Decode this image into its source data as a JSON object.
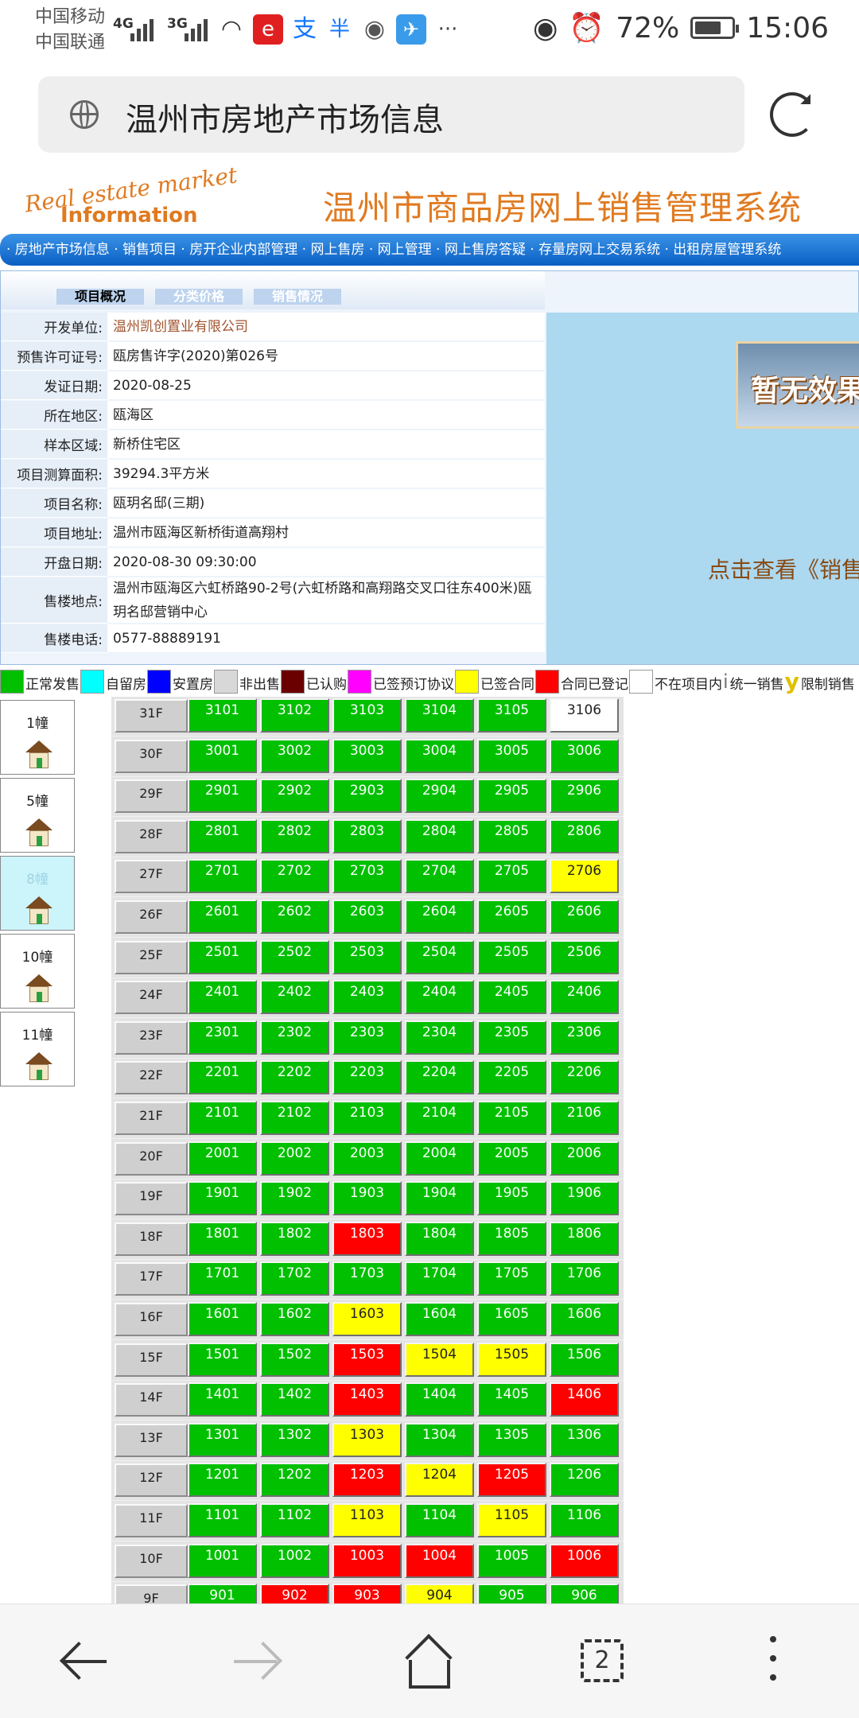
{
  "status": {
    "carrier1": "中国移动",
    "carrier2": "中国联通",
    "net1": "4G",
    "net2": "3G",
    "battery_pct": "72%",
    "time": "15:06",
    "more": "···",
    "battery_level": 0.72,
    "app_icons": [
      "eye-icon",
      "alarm-icon",
      "wifi-icon",
      "red-app-icon",
      "alipay-icon",
      "bank-app-icon",
      "wechat-icon",
      "mail-app-icon"
    ]
  },
  "browser": {
    "url_title": "温州市房地产市场信息",
    "tab_count": "2"
  },
  "site": {
    "logo_line1": "Real estate market",
    "logo_line2": "Information",
    "system_title": "温州市商品房网上销售管理系统",
    "nav_text": "· 房地产市场信息 · 销售项目 · 房开企业内部管理 · 网上售房 · 网上管理 · 网上售房答疑 · 存量房网上交易系统 · 出租房屋管理系统"
  },
  "tabs": [
    "项目概况",
    "分类价格",
    "销售情况"
  ],
  "info": [
    {
      "label": "开发单位:",
      "value": "温州凯创置业有限公司",
      "link": true
    },
    {
      "label": "预售许可证号:",
      "value": "瓯房售许字(2020)第026号"
    },
    {
      "label": "发证日期:",
      "value": "2020-08-25"
    },
    {
      "label": "所在地区:",
      "value": "瓯海区"
    },
    {
      "label": "样本区域:",
      "value": "新桥住宅区"
    },
    {
      "label": "项目测算面积:",
      "value": "39294.3平方米"
    },
    {
      "label": "项目名称:",
      "value": "瓯玥名邸(三期)"
    },
    {
      "label": "项目地址:",
      "value": "温州市瓯海区新桥街道高翔村"
    },
    {
      "label": "开盘日期:",
      "value": "2020-08-30 09:30:00"
    },
    {
      "label": "售楼地点:",
      "value": "温州市瓯海区六虹桥路90-2号(六虹桥路和高翔路交叉口往东400米)瓯玥名邸营销中心"
    },
    {
      "label": "售楼电话:",
      "value": "0577-88889191"
    }
  ],
  "right_panel": {
    "no_image_text": "暂无效果",
    "click_view_text": "点击查看《销售"
  },
  "legend": [
    {
      "type": "swatch",
      "color": "#00c000",
      "label": "正常发售"
    },
    {
      "type": "swatch",
      "color": "#00ffff",
      "label": "自留房"
    },
    {
      "type": "swatch",
      "color": "#0000ff",
      "label": "安置房"
    },
    {
      "type": "swatch",
      "color": "#d8d8d8",
      "label": "非出售"
    },
    {
      "type": "swatch",
      "color": "#6b0000",
      "label": "已认购"
    },
    {
      "type": "swatch",
      "color": "#ff00ff",
      "label": "已签预订协议"
    },
    {
      "type": "swatch",
      "color": "#ffff00",
      "label": "已签合同"
    },
    {
      "type": "swatch",
      "color": "#ff0000",
      "label": "合同已登记"
    },
    {
      "type": "swatch",
      "color": "#ffffff",
      "label": "不在项目内"
    },
    {
      "type": "glyph",
      "glyph": "i",
      "label": "统一销售"
    },
    {
      "type": "glyph",
      "glyph": "y",
      "label": "限制销售"
    }
  ],
  "buildings": [
    {
      "name": "1幢",
      "selected": false
    },
    {
      "name": "5幢",
      "selected": false
    },
    {
      "name": "8幢",
      "selected": true
    },
    {
      "name": "10幢",
      "selected": false
    },
    {
      "name": "11幢",
      "selected": false
    }
  ],
  "floors": [
    {
      "floor": "31F",
      "units": [
        "3101",
        "3102",
        "3103",
        "3104",
        "3105",
        "3106"
      ],
      "status": [
        "g",
        "g",
        "g",
        "g",
        "g",
        "w"
      ]
    },
    {
      "floor": "30F",
      "units": [
        "3001",
        "3002",
        "3003",
        "3004",
        "3005",
        "3006"
      ],
      "status": [
        "g",
        "g",
        "g",
        "g",
        "g",
        "g"
      ]
    },
    {
      "floor": "29F",
      "units": [
        "2901",
        "2902",
        "2903",
        "2904",
        "2905",
        "2906"
      ],
      "status": [
        "g",
        "g",
        "g",
        "g",
        "g",
        "g"
      ]
    },
    {
      "floor": "28F",
      "units": [
        "2801",
        "2802",
        "2803",
        "2804",
        "2805",
        "2806"
      ],
      "status": [
        "g",
        "g",
        "g",
        "g",
        "g",
        "g"
      ]
    },
    {
      "floor": "27F",
      "units": [
        "2701",
        "2702",
        "2703",
        "2704",
        "2705",
        "2706"
      ],
      "status": [
        "g",
        "g",
        "g",
        "g",
        "g",
        "y"
      ]
    },
    {
      "floor": "26F",
      "units": [
        "2601",
        "2602",
        "2603",
        "2604",
        "2605",
        "2606"
      ],
      "status": [
        "g",
        "g",
        "g",
        "g",
        "g",
        "g"
      ]
    },
    {
      "floor": "25F",
      "units": [
        "2501",
        "2502",
        "2503",
        "2504",
        "2505",
        "2506"
      ],
      "status": [
        "g",
        "g",
        "g",
        "g",
        "g",
        "g"
      ]
    },
    {
      "floor": "24F",
      "units": [
        "2401",
        "2402",
        "2403",
        "2404",
        "2405",
        "2406"
      ],
      "status": [
        "g",
        "g",
        "g",
        "g",
        "g",
        "g"
      ]
    },
    {
      "floor": "23F",
      "units": [
        "2301",
        "2302",
        "2303",
        "2304",
        "2305",
        "2306"
      ],
      "status": [
        "g",
        "g",
        "g",
        "g",
        "g",
        "g"
      ]
    },
    {
      "floor": "22F",
      "units": [
        "2201",
        "2202",
        "2203",
        "2204",
        "2205",
        "2206"
      ],
      "status": [
        "g",
        "g",
        "g",
        "g",
        "g",
        "g"
      ]
    },
    {
      "floor": "21F",
      "units": [
        "2101",
        "2102",
        "2103",
        "2104",
        "2105",
        "2106"
      ],
      "status": [
        "g",
        "g",
        "g",
        "g",
        "g",
        "g"
      ]
    },
    {
      "floor": "20F",
      "units": [
        "2001",
        "2002",
        "2003",
        "2004",
        "2005",
        "2006"
      ],
      "status": [
        "g",
        "g",
        "g",
        "g",
        "g",
        "g"
      ]
    },
    {
      "floor": "19F",
      "units": [
        "1901",
        "1902",
        "1903",
        "1904",
        "1905",
        "1906"
      ],
      "status": [
        "g",
        "g",
        "g",
        "g",
        "g",
        "g"
      ]
    },
    {
      "floor": "18F",
      "units": [
        "1801",
        "1802",
        "1803",
        "1804",
        "1805",
        "1806"
      ],
      "status": [
        "g",
        "g",
        "r",
        "g",
        "g",
        "g"
      ]
    },
    {
      "floor": "17F",
      "units": [
        "1701",
        "1702",
        "1703",
        "1704",
        "1705",
        "1706"
      ],
      "status": [
        "g",
        "g",
        "g",
        "g",
        "g",
        "g"
      ]
    },
    {
      "floor": "16F",
      "units": [
        "1601",
        "1602",
        "1603",
        "1604",
        "1605",
        "1606"
      ],
      "status": [
        "g",
        "g",
        "y",
        "g",
        "g",
        "g"
      ]
    },
    {
      "floor": "15F",
      "units": [
        "1501",
        "1502",
        "1503",
        "1504",
        "1505",
        "1506"
      ],
      "status": [
        "g",
        "g",
        "r",
        "y",
        "y",
        "g"
      ]
    },
    {
      "floor": "14F",
      "units": [
        "1401",
        "1402",
        "1403",
        "1404",
        "1405",
        "1406"
      ],
      "status": [
        "g",
        "g",
        "r",
        "g",
        "g",
        "r"
      ]
    },
    {
      "floor": "13F",
      "units": [
        "1301",
        "1302",
        "1303",
        "1304",
        "1305",
        "1306"
      ],
      "status": [
        "g",
        "g",
        "y",
        "g",
        "g",
        "g"
      ]
    },
    {
      "floor": "12F",
      "units": [
        "1201",
        "1202",
        "1203",
        "1204",
        "1205",
        "1206"
      ],
      "status": [
        "g",
        "g",
        "r",
        "y",
        "r",
        "g"
      ]
    },
    {
      "floor": "11F",
      "units": [
        "1101",
        "1102",
        "1103",
        "1104",
        "1105",
        "1106"
      ],
      "status": [
        "g",
        "g",
        "y",
        "g",
        "y",
        "g"
      ]
    },
    {
      "floor": "10F",
      "units": [
        "1001",
        "1002",
        "1003",
        "1004",
        "1005",
        "1006"
      ],
      "status": [
        "g",
        "g",
        "r",
        "r",
        "g",
        "r"
      ]
    },
    {
      "floor": "9F",
      "units": [
        "901",
        "902",
        "903",
        "904",
        "905",
        "906"
      ],
      "status": [
        "g",
        "r",
        "r",
        "y",
        "g",
        "g"
      ]
    }
  ],
  "bottom_nav": [
    "back-icon",
    "forward-icon",
    "home-icon",
    "tabs-icon",
    "more-icon"
  ]
}
